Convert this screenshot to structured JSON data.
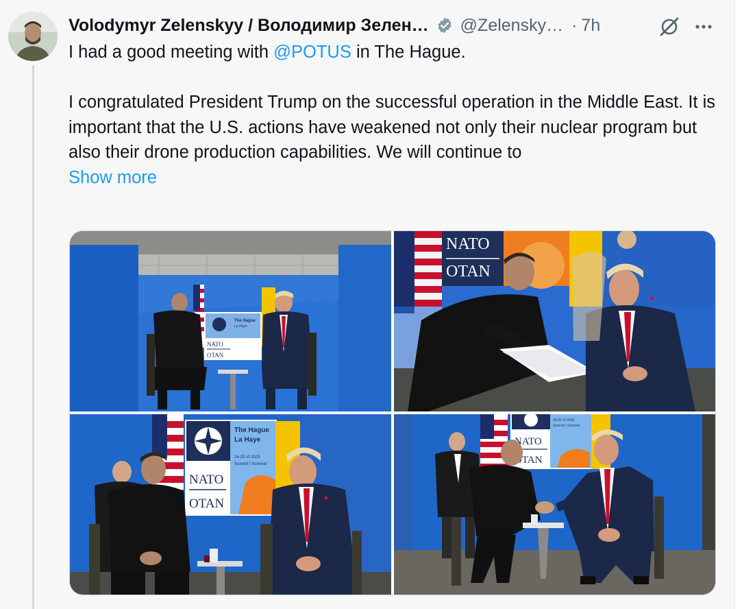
{
  "tweet": {
    "author_name": "Volodymyr Zelenskyy / Володимир Зелен…",
    "handle": "@Zelensky…",
    "separator": "·",
    "time": "7h",
    "text_line1_prefix": "I had a good meeting with ",
    "mention": "@POTUS",
    "text_line1_suffix": " in The Hague.",
    "paragraph2": "I congratulated President Trump on the successful operation in the Middle East. It is important that the U.S. actions have weakened not only their nuclear program but also their drone production capabilities. We will continue to",
    "show_more": "Show more"
  },
  "media": {
    "photo1": {
      "backdrop_title": "The Hague",
      "backdrop_subtitle": "La Haye",
      "org_en": "NATO",
      "org_fr": "OTAN"
    },
    "photo2": {
      "org_en": "NATO",
      "org_fr": "OTAN"
    },
    "photo3": {
      "backdrop_title": "The Hague",
      "backdrop_subtitle": "La Haye",
      "dates": "24-25 VI 2025",
      "summit": "Summit | Sommet",
      "org_en": "NATO",
      "org_fr": "OTAN"
    },
    "photo4": {
      "dates": "24-25 VI 2025",
      "summit": "Summit | Sommet",
      "org_en": "NATO",
      "org_fr": "OTAN"
    }
  },
  "colors": {
    "link": "#1d9bf0",
    "muted_text": "#536471",
    "verified_badge": "#829aab",
    "backdrop_blue": "#1f66c9",
    "nato_navy": "#1d2f5a"
  },
  "icons": {
    "verified": "verified-badge-icon",
    "grok": "grok-icon",
    "more": "more-options-icon"
  }
}
